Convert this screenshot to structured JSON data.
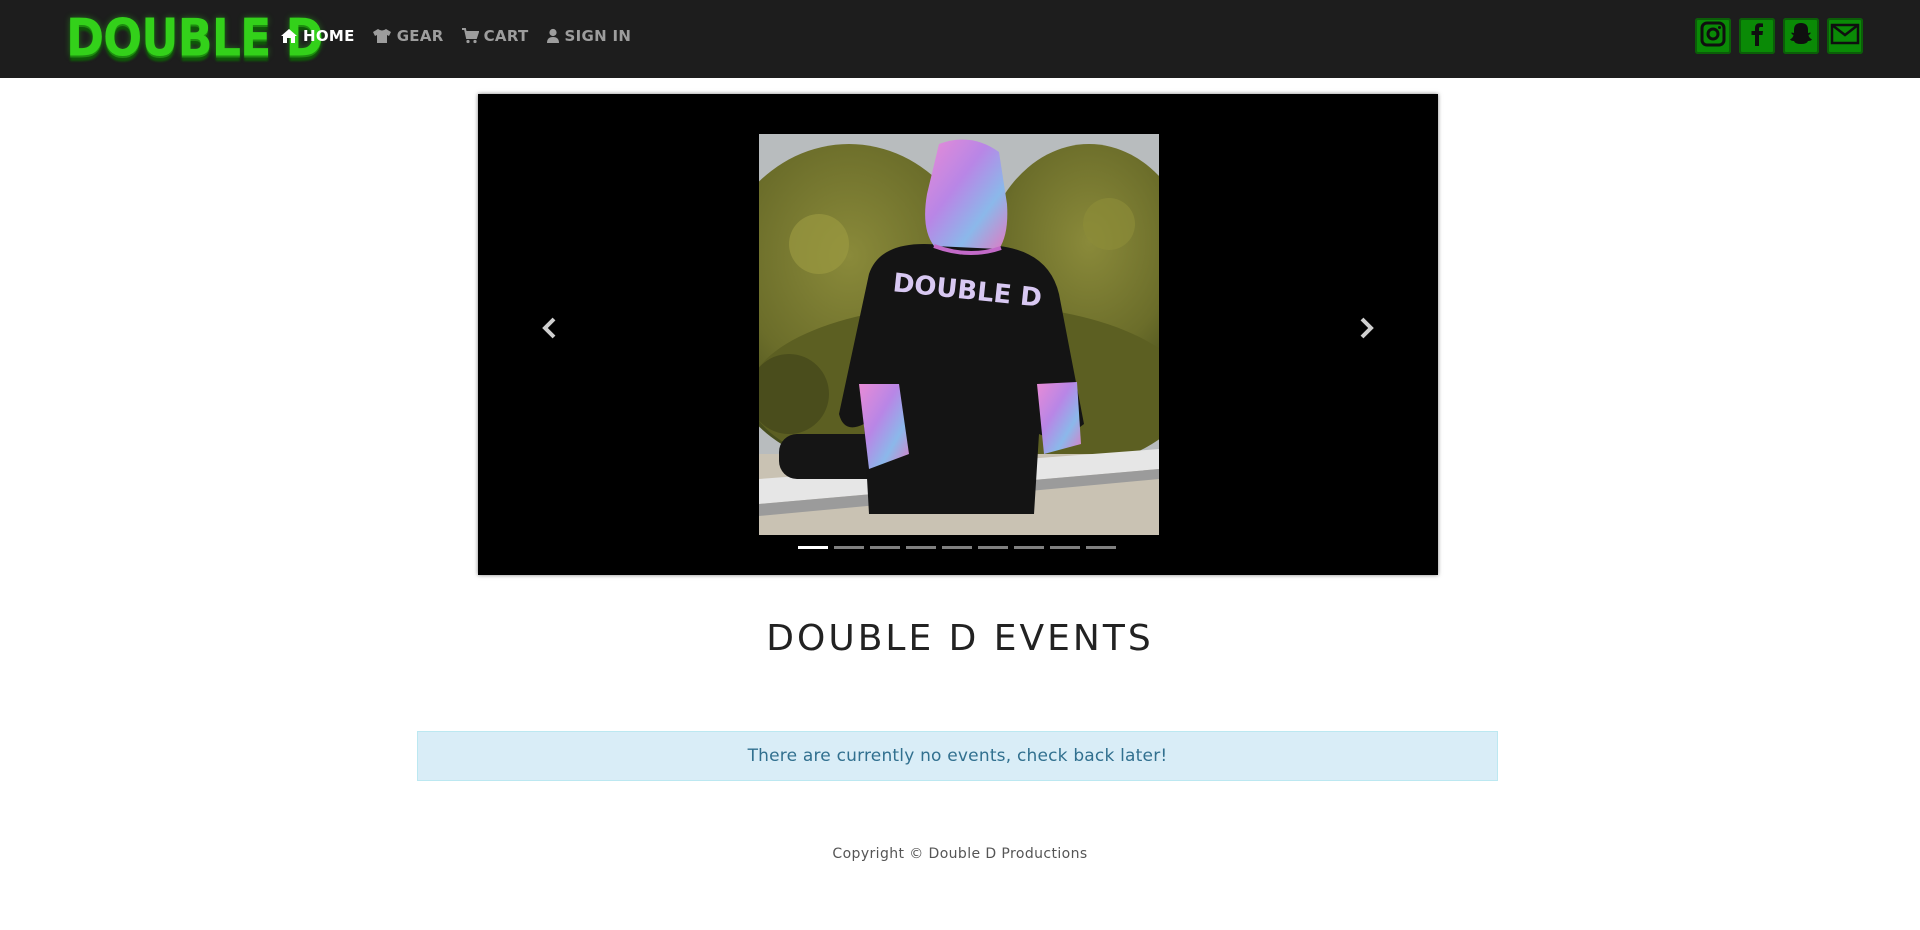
{
  "brand": {
    "logo_text": "DOUBLE D",
    "logo_color": "#33d11a"
  },
  "nav": {
    "items": [
      {
        "label": "HOME",
        "icon": "home-icon",
        "active": true
      },
      {
        "label": "GEAR",
        "icon": "tshirt-icon",
        "active": false
      },
      {
        "label": "CART",
        "icon": "cart-icon",
        "active": false
      },
      {
        "label": "SIGN IN",
        "icon": "user-icon",
        "active": false
      }
    ]
  },
  "social": {
    "color": "#0a8a06",
    "links": [
      "instagram-icon",
      "facebook-icon",
      "snapchat-icon",
      "mail-icon"
    ]
  },
  "carousel": {
    "slide_count": 9,
    "active_index": 0,
    "shirt_text": "DOUBLE D"
  },
  "events": {
    "title": "DOUBLE D EVENTS",
    "empty_message": "There are currently no events, check back later!"
  },
  "footer": {
    "copyright": "Copyright © Double D Productions"
  }
}
